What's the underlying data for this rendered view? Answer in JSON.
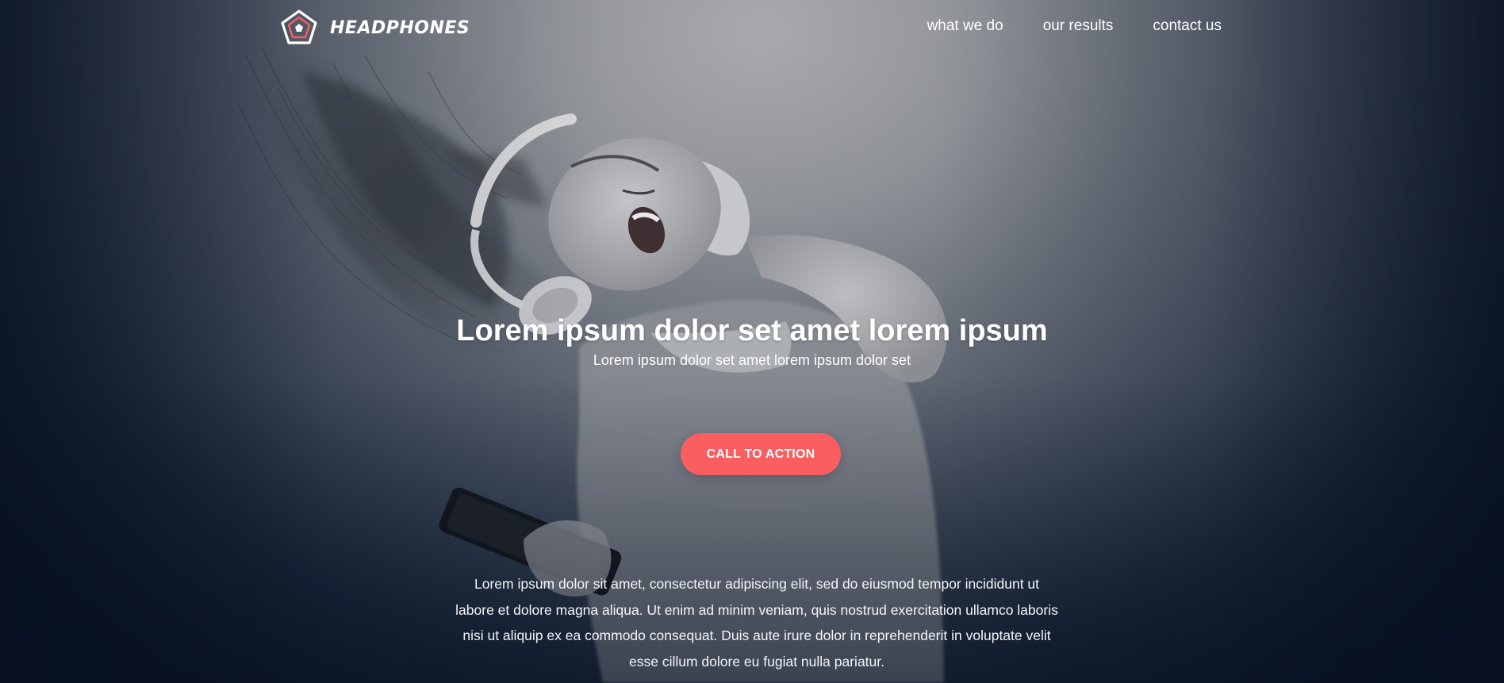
{
  "brand": {
    "name": "HEADPHONES",
    "accent_color": "#fa5e61",
    "logo_icon": "pentagon-logo-icon"
  },
  "nav": {
    "items": [
      {
        "label": "what we do"
      },
      {
        "label": "our results"
      },
      {
        "label": "contact us"
      }
    ]
  },
  "hero": {
    "background_image": "woman-dancing-with-headphones-photo",
    "headline": "Lorem ipsum dolor set amet lorem ipsum",
    "subheadline": "Lorem ipsum dolor set amet lorem ipsum dolor set",
    "cta_label": "CALL TO ACTION",
    "body": "Lorem ipsum dolor sit amet, consectetur adipiscing elit, sed do eiusmod tempor incididunt ut labore et dolore magna aliqua. Ut enim ad minim veniam, quis nostrud exercitation ullamco laboris nisi ut aliquip ex ea commodo consequat. Duis aute irure dolor in reprehenderit in voluptate velit esse cillum dolore eu fugiat nulla pariatur."
  }
}
